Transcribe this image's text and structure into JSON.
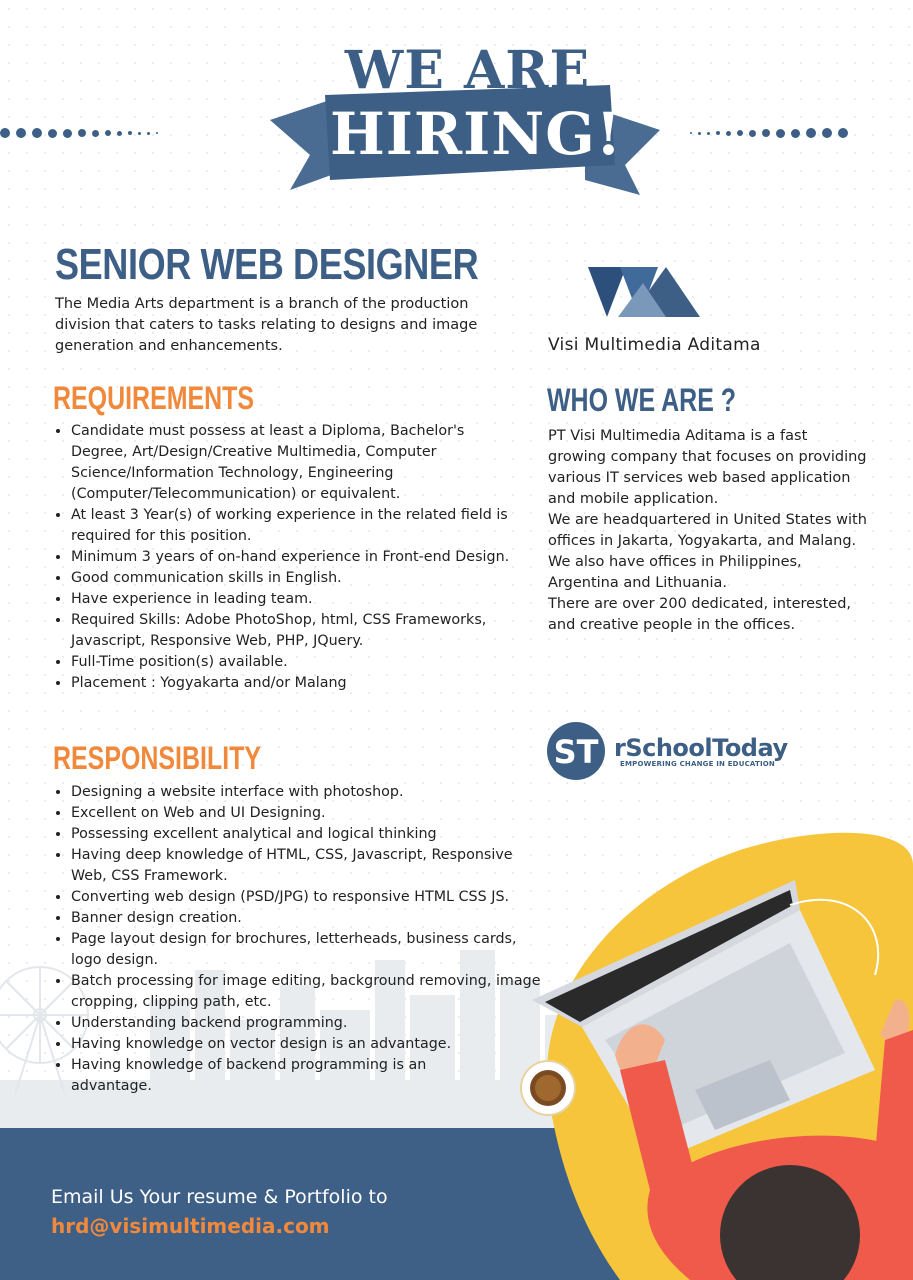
{
  "header": {
    "line1": "WE ARE",
    "line2": "HIRING!"
  },
  "job": {
    "title": "SENIOR WEB DESIGNER",
    "intro": "The Media Arts department is a branch of the production division that caters to tasks relating to designs and image generation and enhancements."
  },
  "requirements": {
    "heading": "REQUIREMENTS",
    "items": [
      "Candidate must possess at least a Diploma, Bachelor's Degree,  Art/Design/Creative Multimedia, Computer Science/Information Technology, Engineering (Computer/Telecommunication) or equivalent.",
      "At least 3 Year(s) of working experience in the related field is required for this position.",
      "Minimum 3 years of on-hand experience in Front-end Design.",
      "Good communication skills in English.",
      "Have experience in leading team.",
      "Required Skills: Adobe PhotoShop, html, CSS Frameworks, Javascript, Responsive Web, PHP, JQuery.",
      "Full-Time position(s) available.",
      "Placement : Yogyakarta and/or Malang"
    ]
  },
  "responsibility": {
    "heading": "RESPONSIBILITY",
    "items": [
      "Designing a website interface with photoshop.",
      "Excellent on Web and UI Designing.",
      "Possessing excellent analytical and logical thinking",
      "Having deep knowledge of HTML, CSS, Javascript, Responsive Web, CSS Framework.",
      "Converting web design (PSD/JPG) to responsive HTML CSS JS.",
      "Banner design creation.",
      "Page layout design for brochures, letterheads, business cards, logo design.",
      "Batch processing for image editing, background removing, image cropping, clipping path, etc.",
      "Understanding backend programming.",
      "Having knowledge on vector design is an advantage.",
      "Having knowledge of backend programming is an advantage."
    ]
  },
  "company": {
    "name": "Visi Multimedia Aditama",
    "who_heading": "WHO WE ARE ?",
    "who_paragraphs": [
      "PT Visi Multimedia Aditama is a fast growing company that focuses on providing various IT services web based application and mobile application.",
      "We are headquartered in United States with offices in Jakarta, Yogyakarta, and Malang.",
      "We also have offices in Philippines, Argentina and Lithuania.",
      "There are over 200 dedicated, interested, and creative people in the offices."
    ]
  },
  "partner": {
    "name": "rSchoolToday",
    "tagline": "EMPOWERING CHANGE IN EDUCATION",
    "monogram": "ST"
  },
  "footer": {
    "line1": "Email Us Your resume & Portfolio to",
    "email": "hrd@visimultimedia.com"
  },
  "colors": {
    "brand_blue": "#3d5f86",
    "accent_orange": "#f0893c",
    "illustration_yellow": "#f7c53c",
    "shirt_red": "#ef5a4a"
  },
  "icons": [
    "coffee-cup-icon",
    "laptop-icon",
    "ferris-wheel-icon",
    "city-skyline-icon"
  ]
}
